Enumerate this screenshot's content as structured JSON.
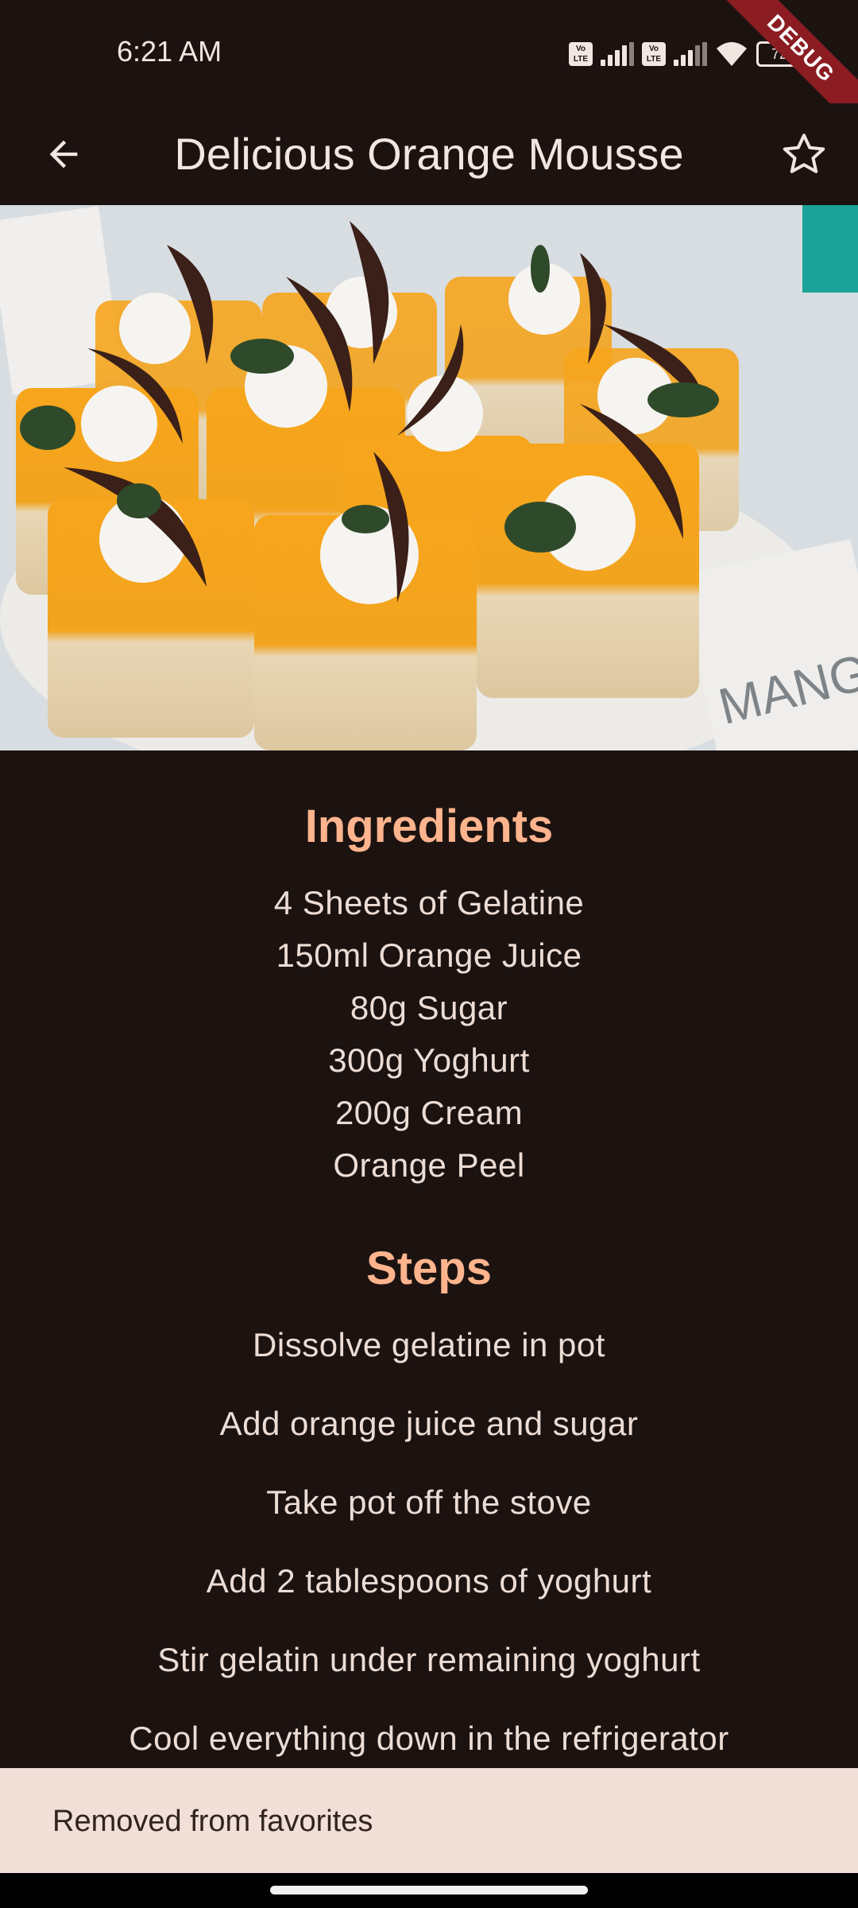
{
  "status_bar": {
    "time": "6:21 AM",
    "battery": "72",
    "debug": "DEBUG",
    "volte_1": "Vo LTE",
    "volte_2": "Vo LTE"
  },
  "app_bar": {
    "title": "Delicious Orange Mousse",
    "back_icon": "arrow-back-icon",
    "favorite_icon": "star-outline-icon"
  },
  "ingredients": {
    "heading": "Ingredients",
    "items": [
      "4 Sheets of Gelatine",
      "150ml Orange Juice",
      "80g Sugar",
      "300g Yoghurt",
      "200g Cream",
      "Orange Peel"
    ]
  },
  "steps": {
    "heading": "Steps",
    "items": [
      "Dissolve gelatine in pot",
      "Add orange juice and sugar",
      "Take pot off the stove",
      "Add 2 tablespoons of yoghurt",
      "Stir gelatin under remaining yoghurt",
      "Cool everything down in the refrigerator"
    ]
  },
  "snackbar": {
    "message": "Removed from favorites"
  },
  "colors": {
    "background": "#1c1311",
    "accent": "#ffb48d",
    "text": "#ecdcd4",
    "snackbar_bg": "#f1dfd8",
    "debug_banner": "#8a1c22"
  }
}
